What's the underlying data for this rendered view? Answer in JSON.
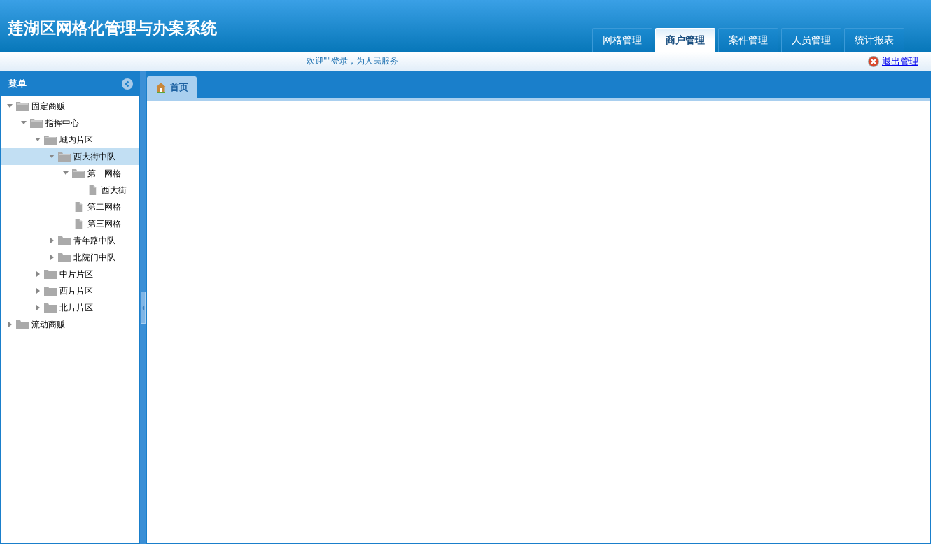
{
  "app_title": "莲湖区网格化管理与办案系统",
  "nav_tabs": [
    {
      "label": "网格管理",
      "selected": false
    },
    {
      "label": "商户管理",
      "selected": true
    },
    {
      "label": "案件管理",
      "selected": false
    },
    {
      "label": "人员管理",
      "selected": false
    },
    {
      "label": "统计报表",
      "selected": false
    }
  ],
  "welcome": "欢迎\"\"登录，为人民服务",
  "logout": "退出管理",
  "sidebar": {
    "title": "菜单",
    "tree": [
      {
        "label": "固定商贩",
        "kind": "folder",
        "expanded": true,
        "selected": false,
        "children": [
          {
            "label": "指挥中心",
            "kind": "folder",
            "expanded": true,
            "selected": false,
            "children": [
              {
                "label": "城内片区",
                "kind": "folder",
                "expanded": true,
                "selected": false,
                "children": [
                  {
                    "label": "西大街中队",
                    "kind": "folder",
                    "expanded": true,
                    "selected": true,
                    "children": [
                      {
                        "label": "第一网格",
                        "kind": "folder",
                        "expanded": true,
                        "selected": false,
                        "children": [
                          {
                            "label": "西大街",
                            "kind": "file",
                            "selected": false
                          }
                        ]
                      },
                      {
                        "label": "第二网格",
                        "kind": "file",
                        "selected": false
                      },
                      {
                        "label": "第三网格",
                        "kind": "file",
                        "selected": false
                      }
                    ]
                  },
                  {
                    "label": "青年路中队",
                    "kind": "folder",
                    "expanded": false,
                    "selected": false
                  },
                  {
                    "label": "北院门中队",
                    "kind": "folder",
                    "expanded": false,
                    "selected": false
                  }
                ]
              },
              {
                "label": "中片片区",
                "kind": "folder",
                "expanded": false,
                "selected": false
              },
              {
                "label": "西片片区",
                "kind": "folder",
                "expanded": false,
                "selected": false
              },
              {
                "label": "北片片区",
                "kind": "folder",
                "expanded": false,
                "selected": false
              }
            ]
          }
        ]
      },
      {
        "label": "流动商贩",
        "kind": "folder",
        "expanded": false,
        "selected": false
      }
    ]
  },
  "content_tabs": [
    {
      "label": "首页",
      "selected": true
    }
  ]
}
